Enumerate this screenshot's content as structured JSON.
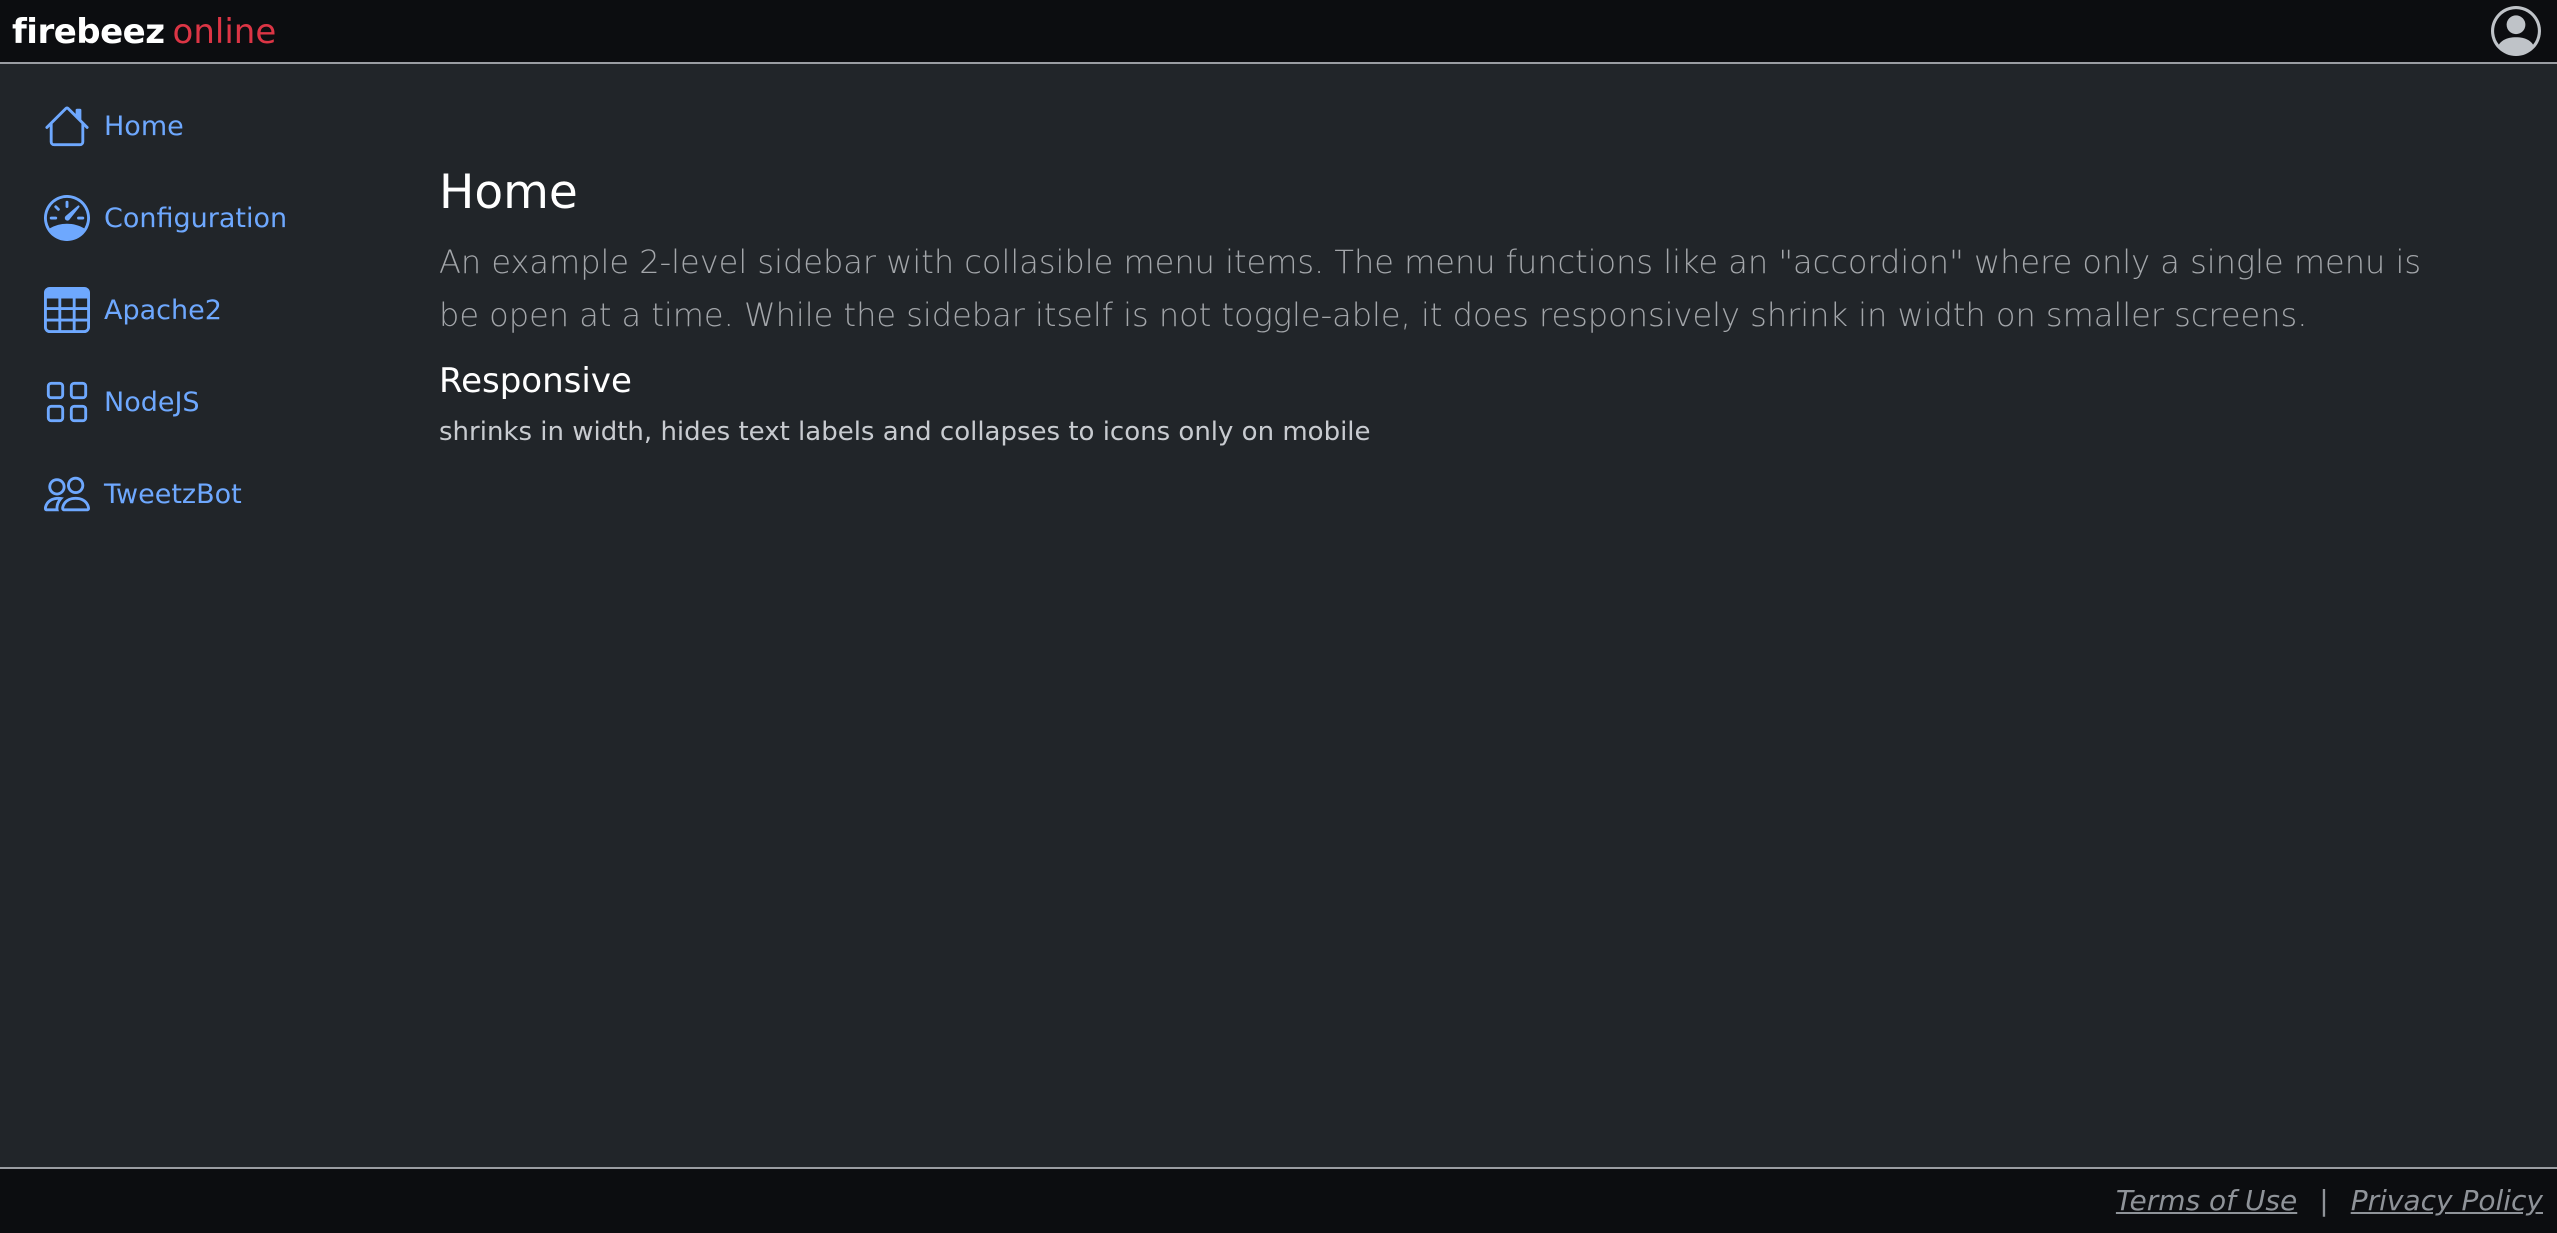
{
  "brand": {
    "name_bold": "firebeez",
    "name_light": "online"
  },
  "header": {
    "avatar_icon": "person-circle-icon"
  },
  "sidebar": {
    "items": [
      {
        "label": "Home",
        "icon": "house-icon"
      },
      {
        "label": "Configuration",
        "icon": "speedometer-icon"
      },
      {
        "label": "Apache2",
        "icon": "table-icon"
      },
      {
        "label": "NodeJS",
        "icon": "grid-icon"
      },
      {
        "label": "TweetzBot",
        "icon": "people-icon"
      }
    ]
  },
  "main": {
    "title": "Home",
    "lead": "An example 2-level sidebar with collasible menu items. The menu functions like an \"accordion\" where only a single menu is be open at a time. While the sidebar itself is not toggle-able, it does responsively shrink in width on smaller screens.",
    "section_title": "Responsive",
    "section_text": "shrinks in width, hides text labels and collapses to icons only on mobile"
  },
  "footer": {
    "terms_label": "Terms of Use",
    "separator": "|",
    "privacy_label": "Privacy Policy"
  },
  "colors": {
    "link": "#6ea8fe",
    "brand_accent": "#dc3545",
    "background": "#212529",
    "bar_background": "#0c0d10"
  }
}
